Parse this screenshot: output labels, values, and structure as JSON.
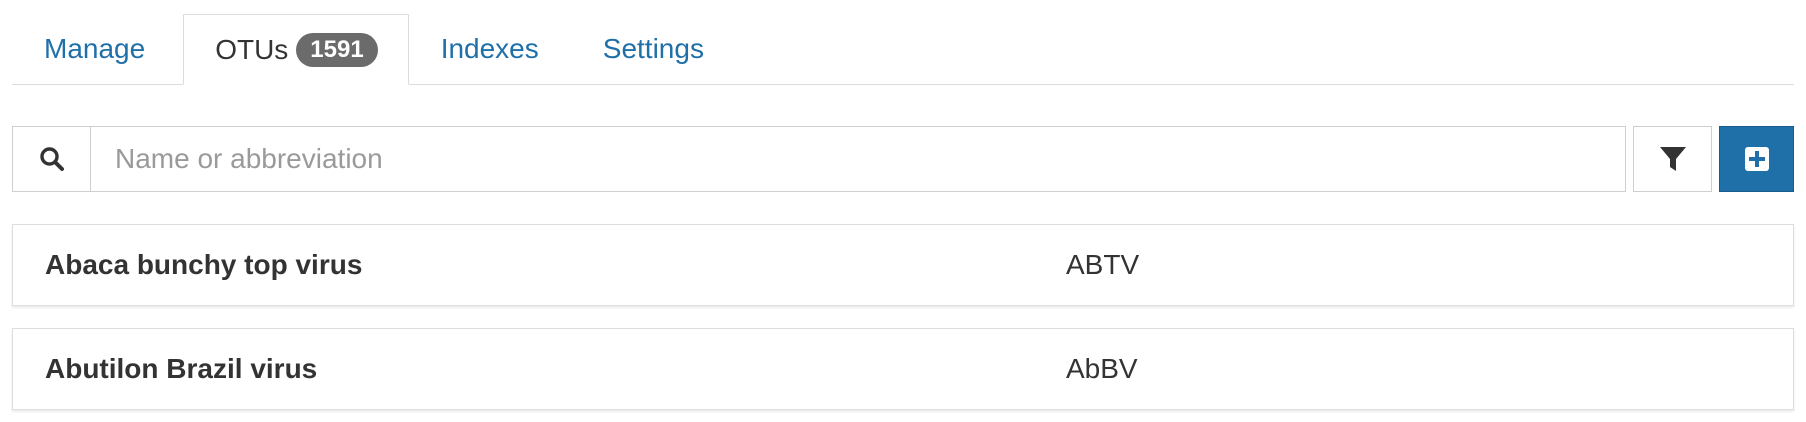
{
  "tabs": [
    {
      "label": "Manage",
      "active": false
    },
    {
      "label": "OTUs",
      "active": true,
      "badge": "1591"
    },
    {
      "label": "Indexes",
      "active": false
    },
    {
      "label": "Settings",
      "active": false
    }
  ],
  "search": {
    "placeholder": "Name or abbreviation",
    "value": "",
    "icon": "search-icon"
  },
  "toolbar": {
    "filter_icon": "filter-icon",
    "create_icon": "plus-square-icon"
  },
  "otus": [
    {
      "name": "Abaca bunchy top virus",
      "abbreviation": "ABTV"
    },
    {
      "name": "Abutilon Brazil virus",
      "abbreviation": "AbBV"
    }
  ],
  "colors": {
    "link": "#1f6fa8",
    "primary_button": "#1f6fa8",
    "badge": "#6b6b6b",
    "text": "#333333"
  }
}
